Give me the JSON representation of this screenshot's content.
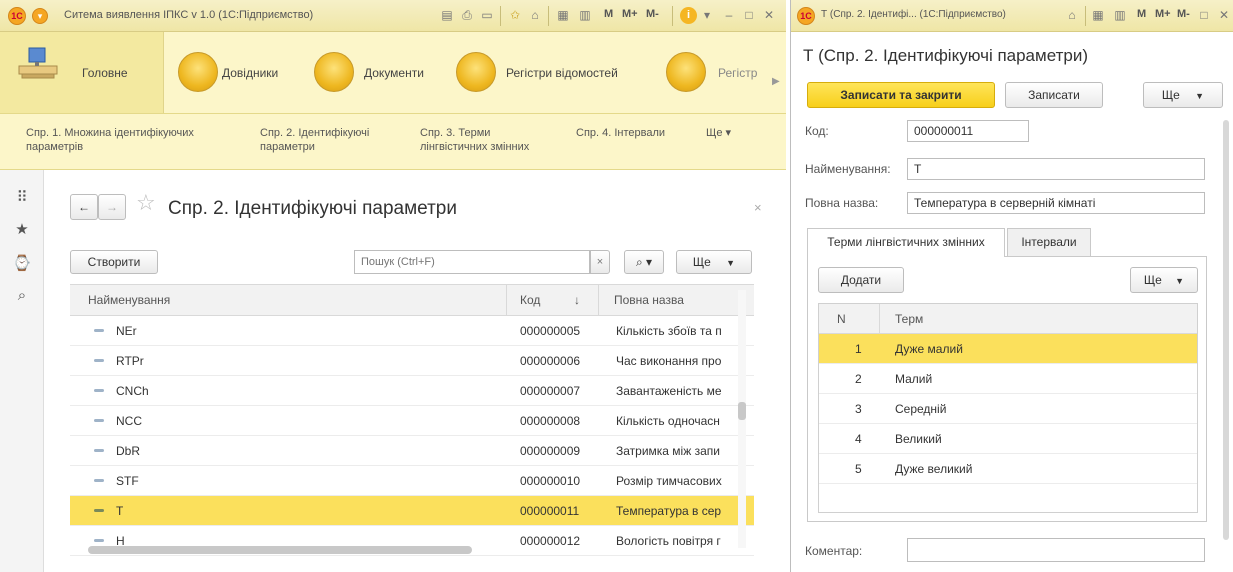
{
  "left_window": {
    "title": "Ситема виявлення ІПКС v 1.0  (1С:Підприємство)",
    "toolbar_m_labels": [
      "M",
      "M+",
      "M-"
    ],
    "sections": [
      {
        "label": "Головне"
      },
      {
        "label": "Довідники"
      },
      {
        "label": "Документи"
      },
      {
        "label": "Регістри відомостей"
      },
      {
        "label": "Регістр"
      }
    ],
    "subnav": [
      {
        "line1": "Спр. 1. Множина ідентифікуючих",
        "line2": "параметрів"
      },
      {
        "line1": "Спр. 2. Ідентифікуючі",
        "line2": "параметри"
      },
      {
        "line1": "Спр. 3. Терми",
        "line2": "лінгвістичних змінних"
      },
      {
        "line1": "Спр. 4. Інтервали",
        "line2": ""
      }
    ],
    "subnav_more": "Ще ▾",
    "form": {
      "title": "Спр. 2. Ідентифікуючі параметри",
      "create_label": "Створити",
      "search_placeholder": "Пошук (Ctrl+F)",
      "more_label": "Ще",
      "columns": [
        "Найменування",
        "Код",
        "Повна назва"
      ],
      "rows": [
        {
          "name": "NEr",
          "code": "000000005",
          "full": "Кількість збоїв та п"
        },
        {
          "name": "RTPr",
          "code": "000000006",
          "full": "Час виконання про"
        },
        {
          "name": "CNCh",
          "code": "000000007",
          "full": "Завантаженість ме"
        },
        {
          "name": "NCC",
          "code": "000000008",
          "full": "Кількість одночасн"
        },
        {
          "name": "DbR",
          "code": "000000009",
          "full": "Затримка між запи"
        },
        {
          "name": "STF",
          "code": "000000010",
          "full": "Розмір тимчасових"
        },
        {
          "name": "T",
          "code": "000000011",
          "full": "Температура в сер"
        },
        {
          "name": "H",
          "code": "000000012",
          "full": "Вологість повітря г"
        }
      ],
      "selected_row": 6
    }
  },
  "right_window": {
    "title": "Т (Спр. 2. Ідентифі...  (1С:Підприємство)",
    "toolbar_m_labels": [
      "M",
      "M+",
      "M-"
    ],
    "heading": "Т (Спр. 2. Ідентифікуючі параметри)",
    "save_close_label": "Записати та закрити",
    "save_label": "Записати",
    "more_label": "Ще",
    "fields": {
      "code_label": "Код:",
      "code_value": "000000011",
      "name_label": "Найменування:",
      "name_value": "T",
      "full_label": "Повна назва:",
      "full_value": "Температура в серверній кімнаті",
      "comment_label": "Коментар:",
      "comment_value": ""
    },
    "tabs": [
      {
        "label": "Терми лінгвістичних змінних"
      },
      {
        "label": "Інтервали"
      }
    ],
    "add_label": "Додати",
    "terms_columns": [
      "N",
      "Терм"
    ],
    "terms": [
      {
        "n": "1",
        "term": "Дуже малий"
      },
      {
        "n": "2",
        "term": "Малий"
      },
      {
        "n": "3",
        "term": "Середній"
      },
      {
        "n": "4",
        "term": "Великий"
      },
      {
        "n": "5",
        "term": "Дуже великий"
      }
    ],
    "selected_term": 0
  }
}
